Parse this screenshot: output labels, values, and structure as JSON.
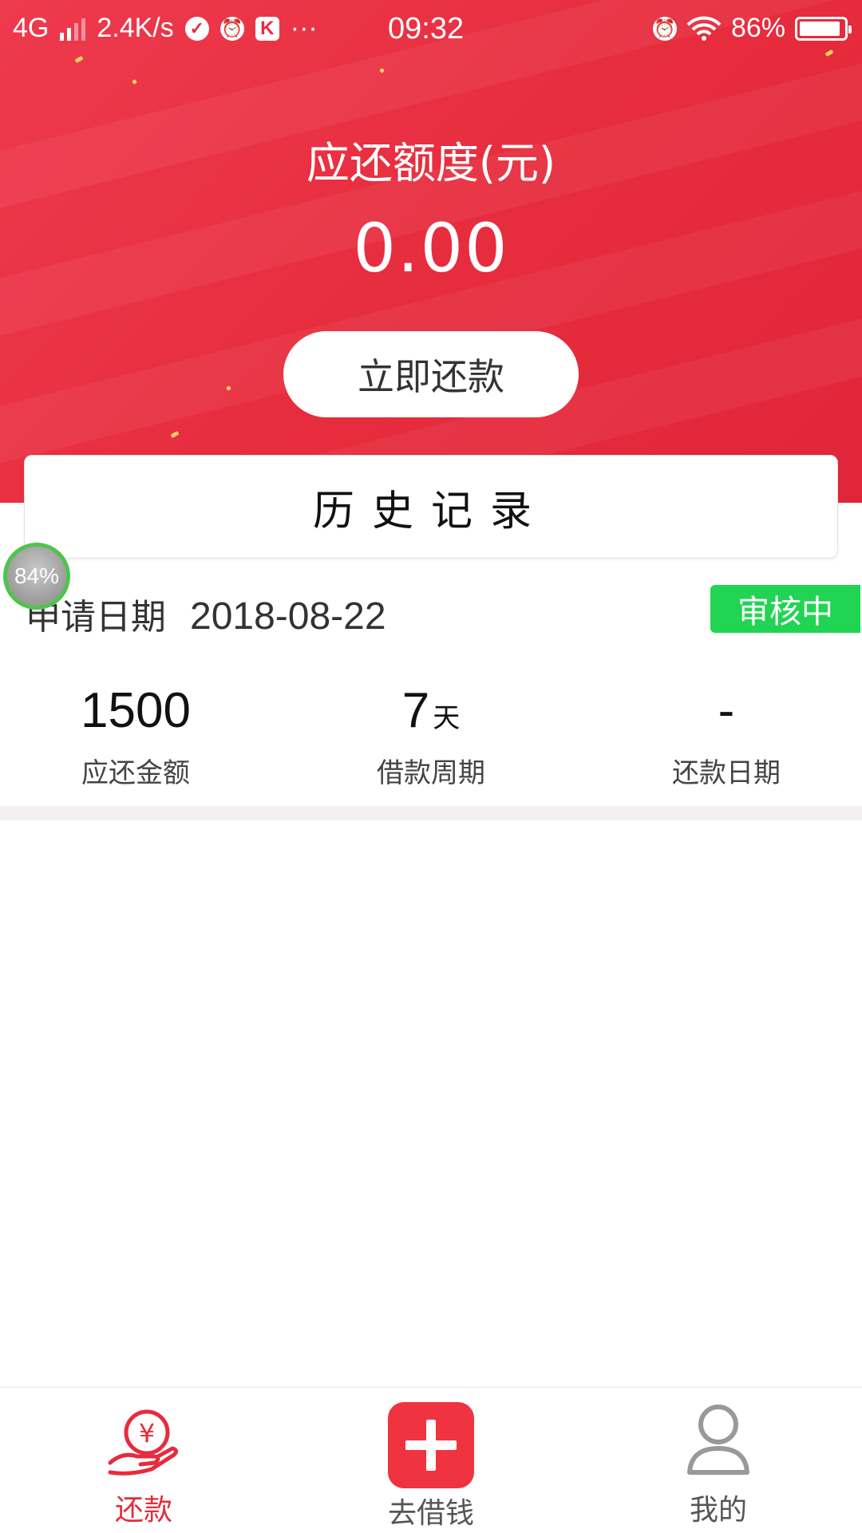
{
  "status_bar": {
    "network": "4G",
    "speed": "2.4K/s",
    "app_icon_letter": "K",
    "more": "···",
    "time": "09:32",
    "battery": "86%"
  },
  "hero": {
    "title": "应还额度(元)",
    "amount": "0.00",
    "repay_button": "立即还款"
  },
  "history": {
    "title": "历史记录"
  },
  "floating_ball": {
    "label": "84%"
  },
  "record": {
    "date_label": "申请日期",
    "date_value": "2018-08-22",
    "status": "审核中",
    "status_color": "#21d453",
    "stats": [
      {
        "value": "1500",
        "unit": "",
        "label": "应还金额"
      },
      {
        "value": "7",
        "unit": "天",
        "label": "借款周期"
      },
      {
        "value": "-",
        "unit": "",
        "label": "还款日期"
      }
    ]
  },
  "tabbar": {
    "items": [
      {
        "label": "还款",
        "icon": "hand-yuan-icon",
        "active": true
      },
      {
        "label": "去借钱",
        "icon": "plus-icon",
        "active": false
      },
      {
        "label": "我的",
        "icon": "user-icon",
        "active": false
      }
    ],
    "accent": "#e62c3d"
  }
}
